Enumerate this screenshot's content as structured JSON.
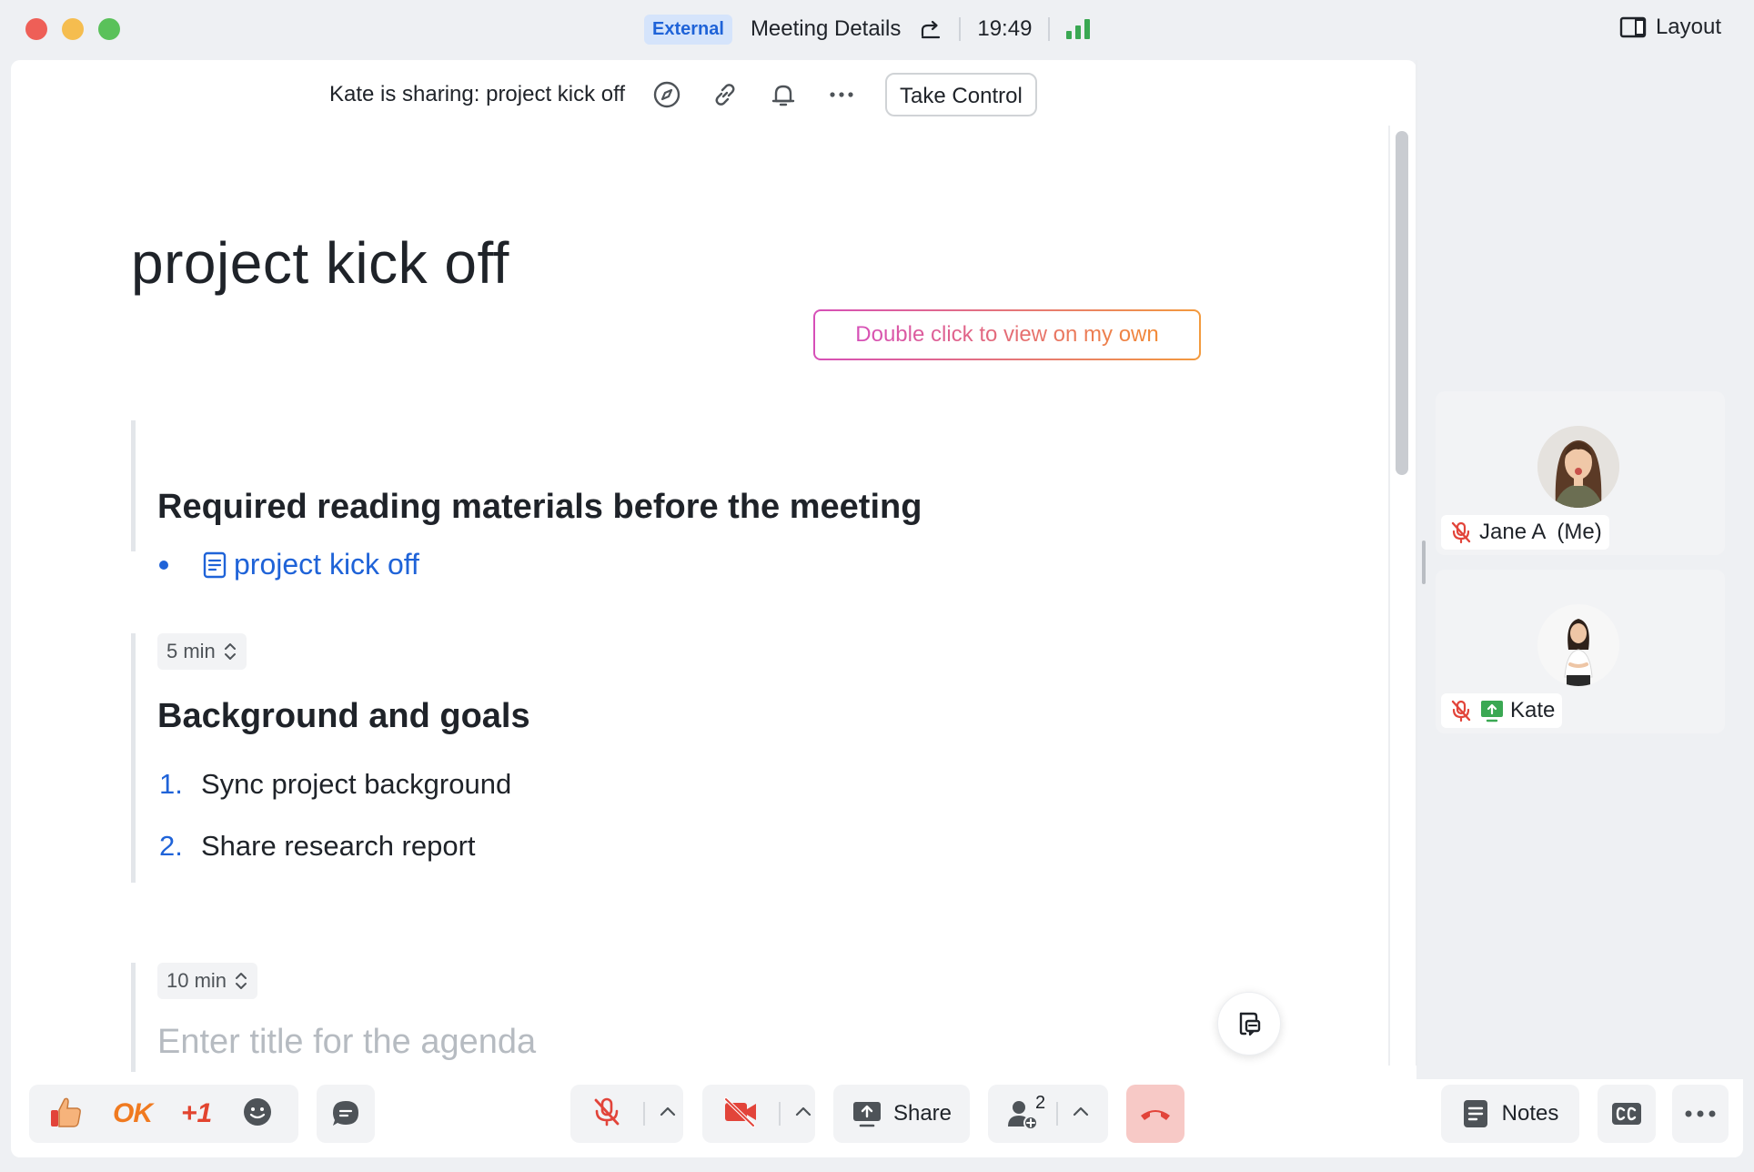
{
  "titlebar": {
    "badge": "External",
    "title": "Meeting Details",
    "time": "19:49",
    "layout_label": "Layout"
  },
  "sharebar": {
    "sharing_text": "Kate is sharing: project kick off",
    "take_control_label": "Take Control"
  },
  "doc": {
    "title": "project kick off",
    "double_click_hint": "Double click to view on my own",
    "section1": {
      "heading": "Required reading materials before the meeting",
      "link_label": "project kick off"
    },
    "section2": {
      "duration": "5 min",
      "heading": "Background and goals",
      "items": [
        {
          "num": "1.",
          "text": "Sync project background"
        },
        {
          "num": "2.",
          "text": "Share research report"
        }
      ]
    },
    "section3": {
      "duration": "10 min",
      "placeholder": "Enter title for the agenda"
    }
  },
  "participants": [
    {
      "name": "Jane A  (Me)",
      "muted": true,
      "sharing": false
    },
    {
      "name": "Kate",
      "muted": true,
      "sharing": true
    }
  ],
  "toolbar": {
    "ok_label": "OK",
    "plus_one_label": "+1",
    "share_label": "Share",
    "participant_count": "2",
    "notes_label": "Notes"
  },
  "colors": {
    "accent": "#1f63d8",
    "signal": "#3aa853",
    "end_call": "#e2443a",
    "muted_red": "#e2443a"
  }
}
